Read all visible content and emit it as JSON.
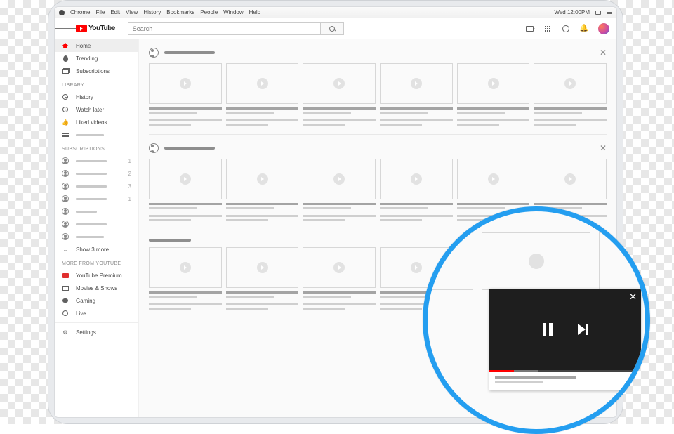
{
  "menubar": {
    "items": [
      "Chrome",
      "File",
      "Edit",
      "View",
      "History",
      "Bookmarks",
      "People",
      "Window",
      "Help"
    ],
    "clock": "Wed 12:00PM"
  },
  "yt": {
    "brand": "YouTube",
    "search_placeholder": "Search"
  },
  "sidebar": {
    "primary": [
      {
        "label": "Home",
        "icon": "home"
      },
      {
        "label": "Trending",
        "icon": "flame"
      },
      {
        "label": "Subscriptions",
        "icon": "stack"
      }
    ],
    "library_head": "LIBRARY",
    "library": [
      {
        "label": "History",
        "icon": "clock"
      },
      {
        "label": "Watch later",
        "icon": "clock"
      },
      {
        "label": "Liked videos",
        "icon": "thumb"
      },
      {
        "label": "",
        "icon": "three"
      }
    ],
    "subs_head": "SUBSCRIPTIONS",
    "sub_counts": [
      "1",
      "2",
      "3",
      "1",
      "",
      "",
      ""
    ],
    "show_more": "Show 3 more",
    "more_head": "MORE FROM YOUTUBE",
    "more": [
      {
        "label": "YouTube Premium"
      },
      {
        "label": "Movies & Shows"
      },
      {
        "label": "Gaming"
      },
      {
        "label": "Live"
      }
    ],
    "settings": "Settings"
  },
  "colors": {
    "accent": "#ff0000",
    "zoom_ring": "#249ef0"
  }
}
